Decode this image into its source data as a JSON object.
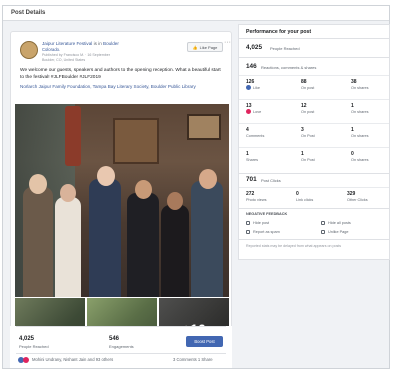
{
  "header": {
    "title": "Post Details"
  },
  "post": {
    "page_name": "Jaipur Literature Festival",
    "is_in_text": "is in",
    "location": "Boulder",
    "line2": "Colorado.",
    "meta_line": "Published by Francisco M. · 16 September",
    "place_line": "Boulder, CO, United States",
    "like_page_label": "Like Page",
    "body": "We welcome our guests, speakers and authors to the opening reception. What a beautiful start to the festival! #JLFBoulder #JLF2019",
    "tags": "Norlarch Jaipur Family Foundation, Tampa Bay Literary Society, Boulder Public Library",
    "more_photos": "+10",
    "people_reached_value": "4,025",
    "people_reached_label": "People Reached",
    "engagements_value": "546",
    "engagements_label": "Engagements",
    "boost_label": "Boost Post",
    "reactions_text": "Mohini Undrany, Nishant Jain and 93 others",
    "comments_shares": "3 Comments  1 Share"
  },
  "performance": {
    "title": "Performance for your post",
    "reached_value": "4,025",
    "reached_label": "People Reached",
    "reactions_value": "146",
    "reactions_label": "Reactions, comments & shares",
    "grid": [
      {
        "v": "126",
        "l": "Like",
        "v2": "88",
        "l2": "On post",
        "v3": "38",
        "l3": "On shares"
      },
      {
        "v": "13",
        "l": "Love",
        "v2": "12",
        "l2": "On post",
        "v3": "1",
        "l3": "On shares"
      },
      {
        "v": "4",
        "l": "Comments",
        "v2": "3",
        "l2": "On Post",
        "v3": "1",
        "l3": "On shares"
      },
      {
        "v": "1",
        "l": "Shares",
        "v2": "1",
        "l2": "On Post",
        "v3": "0",
        "l3": "On shares"
      }
    ],
    "clicks_value": "701",
    "clicks_label": "Post Clicks",
    "clicks_breakdown": [
      {
        "v": "272",
        "l": "Photo views"
      },
      {
        "v": "0",
        "l": "Link clicks"
      },
      {
        "v": "329",
        "l": "Other Clicks"
      }
    ],
    "negative_title": "NEGATIVE FEEDBACK",
    "negative_items": [
      "Hide post",
      "Hide all posts",
      "Report as spam",
      "Unlike Page"
    ],
    "footnote": "Reported stats may be delayed from what appears on posts"
  }
}
